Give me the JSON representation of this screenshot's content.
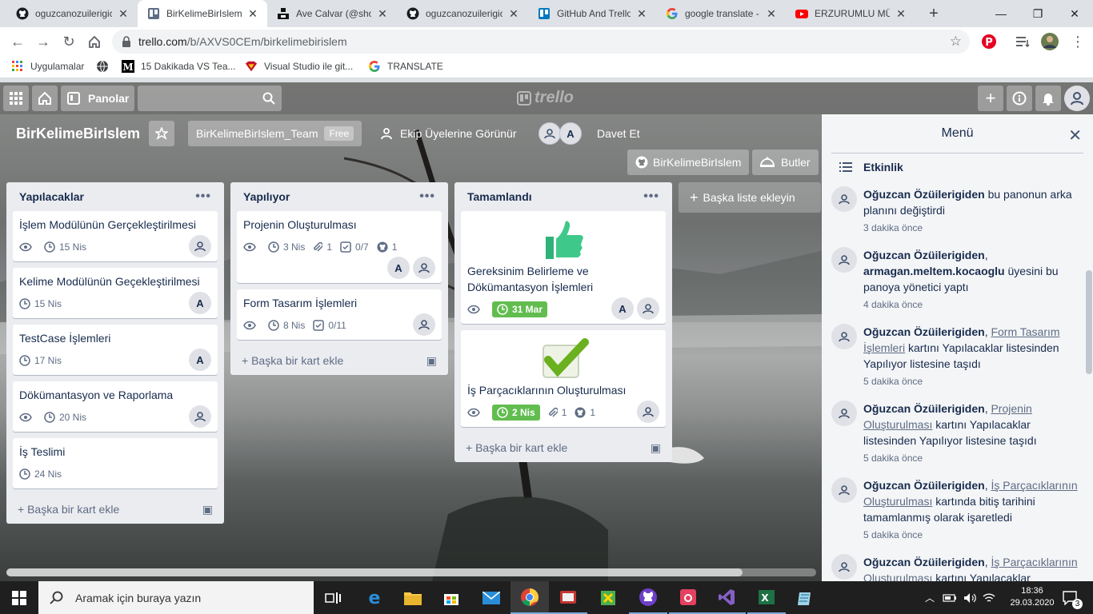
{
  "browser": {
    "tabs": [
      {
        "title": "oguzcanozuilerigic",
        "icon": "github-icon",
        "active": false
      },
      {
        "title": "BirKelimeBirIslem |",
        "icon": "trello-icon",
        "active": true
      },
      {
        "title": "Ave Calvar (@shot",
        "icon": "unsplash-icon",
        "active": false
      },
      {
        "title": "oguzcanozuilerigic",
        "icon": "github-icon",
        "active": false
      },
      {
        "title": "GitHub And Trello",
        "icon": "trello-blue-icon",
        "active": false
      },
      {
        "title": "google translate -",
        "icon": "google-icon",
        "active": false
      },
      {
        "title": "ERZURUMLU MÜN",
        "icon": "youtube-icon",
        "active": false
      }
    ],
    "url_host": "trello.com",
    "url_path": "/b/AXVS0CEm/birkelimebirislem",
    "bookmarks": [
      {
        "label": "Uygulamalar",
        "icon": "apps-grid-icon"
      },
      {
        "label": "",
        "icon": "globe-icon"
      },
      {
        "label": "15 Dakikada VS Tea...",
        "icon": "medium-icon"
      },
      {
        "label": "Visual Studio ile git...",
        "icon": "superman-icon"
      },
      {
        "label": "TRANSLATE",
        "icon": "google-icon"
      }
    ]
  },
  "trello": {
    "top": {
      "boards_label": "Panolar",
      "logo_text": "trello"
    },
    "board": {
      "name": "BirKelimeBirIslem",
      "team": "BirKelimeBirIslem_Team",
      "team_badge": "Free",
      "visibility": "Ekip Üyelerine Görünür",
      "invite": "Davet Et",
      "powerup_github": "BirKelimeBirIslem",
      "butler": "Butler"
    },
    "lists": [
      {
        "name": "Yapılacaklar",
        "add_card": "Başka bir kart ekle",
        "cards": [
          {
            "title": "İşlem Modülünün Gerçekleştirilmesi",
            "watch": true,
            "due": "15 Nis",
            "members": [
              "avatar"
            ]
          },
          {
            "title": "Kelime Modülünün Geçekleştirilmesi",
            "watch": false,
            "due": "15 Nis",
            "members": [
              "A"
            ]
          },
          {
            "title": "TestCase İşlemleri",
            "watch": false,
            "due": "17 Nis",
            "members": [
              "A"
            ]
          },
          {
            "title": "Dökümantasyon ve Raporlama",
            "watch": true,
            "due": "20 Nis",
            "members": [
              "avatar"
            ]
          },
          {
            "title": "İş Teslimi",
            "watch": false,
            "due": "24 Nis",
            "members": []
          }
        ]
      },
      {
        "name": "Yapılıyor",
        "add_card": "Başka bir kart ekle",
        "cards": [
          {
            "title": "Projenin Oluşturulması",
            "watch": true,
            "due": "3 Nis",
            "attachments": "1",
            "checklist": "0/7",
            "github": "1",
            "members": [
              "A",
              "avatar"
            ]
          },
          {
            "title": "Form Tasarım İşlemleri",
            "watch": true,
            "due": "8 Nis",
            "checklist": "0/11",
            "members": [
              "avatar"
            ]
          }
        ]
      },
      {
        "name": "Tamamlandı",
        "add_card": "Başka bir kart ekle",
        "cards": [
          {
            "title": "Gereksinim Belirleme ve Dökümantasyon İşlemleri",
            "cover": "thumbs-up-sticker",
            "watch": true,
            "due": "31 Mar",
            "due_complete": true,
            "members": [
              "A",
              "avatar"
            ]
          },
          {
            "title": "İş Parçacıklarının Oluşturulması",
            "cover": "checkmark-sticker",
            "watch": true,
            "due": "2 Nis",
            "due_complete": true,
            "attachments": "1",
            "github": "1",
            "members": [
              "avatar"
            ]
          }
        ]
      }
    ],
    "add_list": "Başka liste ekleyin",
    "menu": {
      "title": "Menü",
      "activity_heading": "Etkinlik",
      "items": [
        {
          "user": "Oğuzcan Özüilerigiden",
          "text": " bu panonun arka planını değiştirdi",
          "when": "3 dakika önce"
        },
        {
          "user": "Oğuzcan Özüilerigiden",
          "text": ", ",
          "target_user": "armagan.meltem.kocaoglu",
          "text2": " üyesini bu panoya yönetici yaptı",
          "when": "4 dakika önce"
        },
        {
          "user": "Oğuzcan Özüilerigiden",
          "text": ", ",
          "link": "Form Tasarım İşlemleri",
          "text2": " kartını Yapılacaklar listesinden Yapılıyor listesine taşıdı",
          "when": "5 dakika önce"
        },
        {
          "user": "Oğuzcan Özüilerigiden",
          "text": ", ",
          "link": "Projenin Oluşturulması",
          "text2": " kartını Yapılacaklar listesinden Yapılıyor listesine taşıdı",
          "when": "5 dakika önce"
        },
        {
          "user": "Oğuzcan Özüilerigiden",
          "text": ", ",
          "link": "İş Parçacıklarının Oluşturulması",
          "text2": " kartında bitiş tarihini tamamlanmış olarak işaretledi",
          "when": "5 dakika önce"
        },
        {
          "user": "Oğuzcan Özüilerigiden",
          "text": ", ",
          "link": "İş Parçacıklarının Oluşturulması",
          "text2": " kartını Yapılacaklar",
          "when": ""
        }
      ]
    }
  },
  "taskbar": {
    "search_placeholder": "Aramak için buraya yazın",
    "time": "18:36",
    "date": "29.03.2020",
    "notifications": "3"
  },
  "colors": {
    "due_complete": "#61bd4f",
    "list_bg": "#ebecf0",
    "menu_bg": "#f4f5f7",
    "taskbar": "#1f1f1f"
  }
}
